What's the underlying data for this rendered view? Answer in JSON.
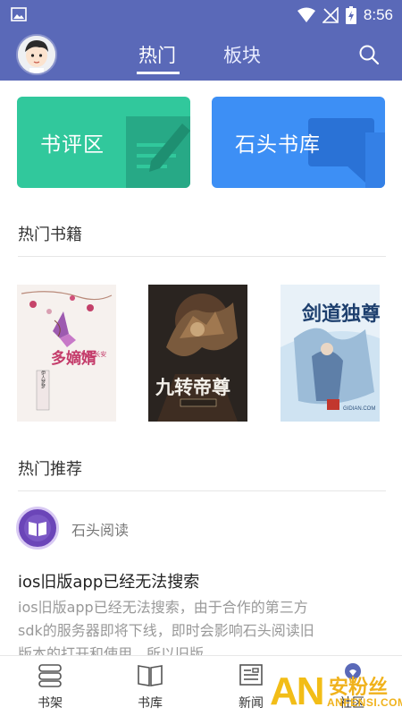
{
  "status_bar": {
    "time": "8:56"
  },
  "header": {
    "tabs": [
      {
        "label": "热门",
        "active": true
      },
      {
        "label": "板块",
        "active": false
      }
    ]
  },
  "banners": [
    {
      "label": "书评区",
      "color": "#31c89c"
    },
    {
      "label": "石头书库",
      "color": "#3d8ff5"
    }
  ],
  "hot_books": {
    "title": "热门书籍",
    "books": [
      {
        "cover_title": "多嫡婿",
        "cover_subtitle": "大婚·长安",
        "author": "伊人梦梦"
      },
      {
        "cover_title": "九转帝尊",
        "cover_subtitle": ""
      },
      {
        "cover_title": "剑道独尊",
        "cover_subtitle": "GIDIAN.COM"
      }
    ]
  },
  "recommend": {
    "title": "热门推荐",
    "author": "石头阅读",
    "post_title": "ios旧版app已经无法搜索",
    "post_body": "ios旧版app已经无法搜索，由于合作的第三方sdk的服务器即将下线，即时会影响石头阅读旧版本的打开和使用，所以旧版"
  },
  "bottom_nav": [
    {
      "label": "书架",
      "icon": "bookshelf-icon"
    },
    {
      "label": "书库",
      "icon": "book-open-icon"
    },
    {
      "label": "新闻",
      "icon": "news-icon"
    },
    {
      "label": "社区",
      "icon": "community-icon"
    }
  ],
  "watermark": {
    "brand": "AN",
    "name": "安粉丝",
    "url": "ANFENSI.COM"
  },
  "colors": {
    "primary": "#5a69b8",
    "review": "#31c89c",
    "library": "#3d8ff5"
  }
}
